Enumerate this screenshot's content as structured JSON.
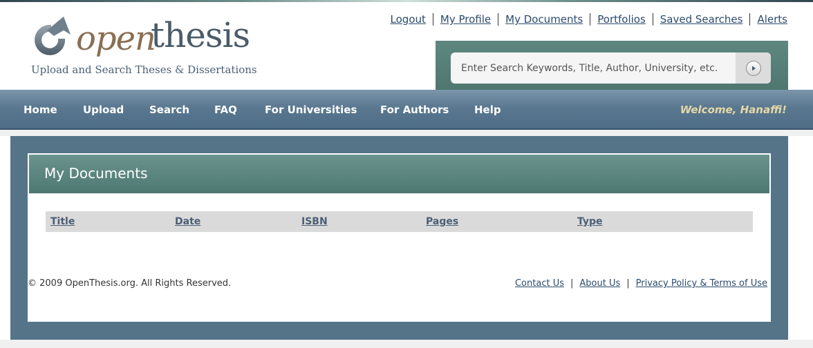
{
  "logo": {
    "word_open": "open",
    "word_thesis": "thesis",
    "tagline": "Upload and Search Theses & Dissertations",
    "mark_icon": "circular-arrow-icon"
  },
  "top_links": [
    "Logout",
    "My Profile",
    "My Documents",
    "Portfolios",
    "Saved Searches",
    "Alerts"
  ],
  "search": {
    "placeholder": "Enter Search Keywords, Title, Author, University, etc.",
    "button_icon": "play-arrow-icon"
  },
  "nav": {
    "items": [
      "Home",
      "Upload",
      "Search",
      "FAQ",
      "For Universities",
      "For Authors",
      "Help"
    ],
    "welcome": "Welcome, Hanaffi!"
  },
  "panel": {
    "title": "My Documents",
    "columns": [
      "Title",
      "Date",
      "ISBN",
      "Pages",
      "Type"
    ]
  },
  "footer": {
    "copyright": "© 2009 OpenThesis.org. All Rights Reserved.",
    "links": [
      "Contact Us",
      "About Us",
      "Privacy Policy & Terms of Use"
    ],
    "separator": "|"
  },
  "colors": {
    "nav_bg": "#5a7890",
    "frame_bg": "#557488",
    "panel_header": "#5d857f",
    "search_bg": "#577f78",
    "welcome_text": "#e6d8a6",
    "link": "#2b4a6b"
  }
}
